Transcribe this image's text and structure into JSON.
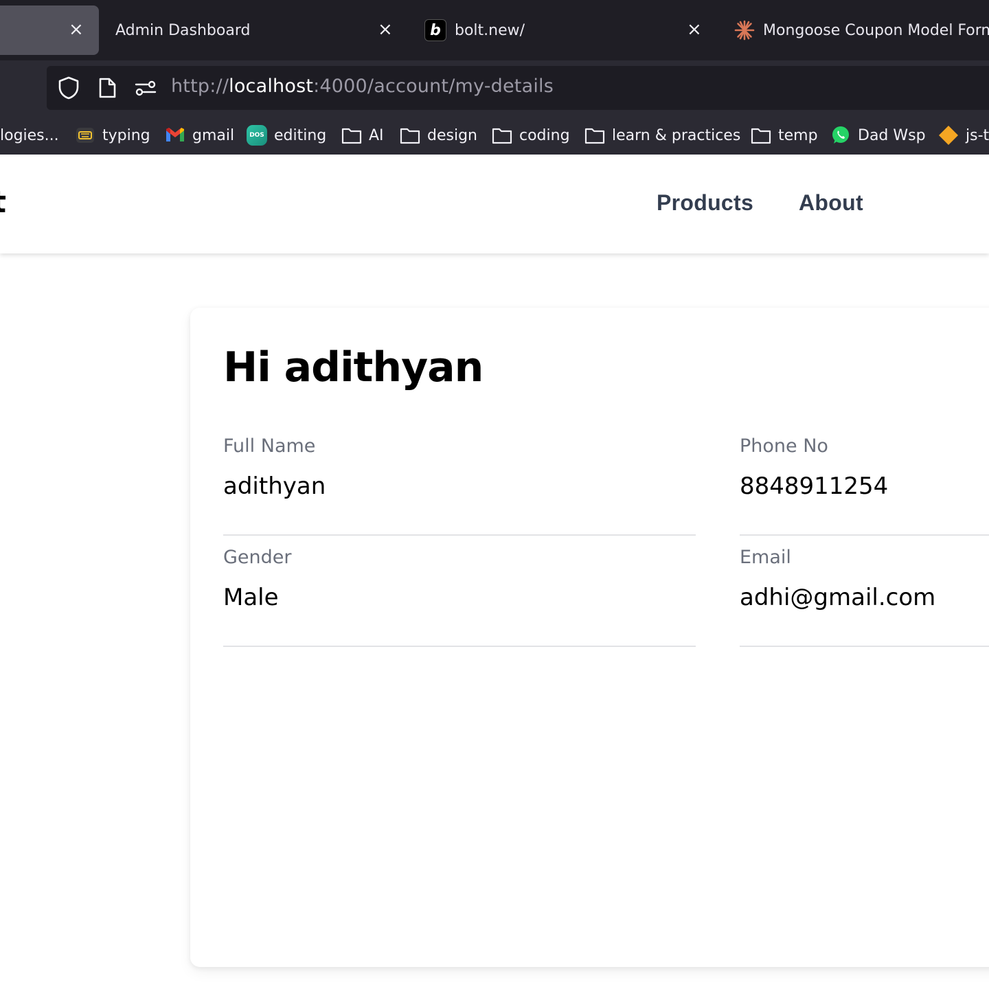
{
  "browser": {
    "tabs": [
      {
        "title": "",
        "active": true
      },
      {
        "title": "Admin Dashboard",
        "active": false
      },
      {
        "title": "bolt.new/",
        "active": false
      },
      {
        "title": "Mongoose Coupon Model Form",
        "active": false
      }
    ],
    "close_glyph": "×",
    "url": {
      "scheme": "http://",
      "host": "localhost",
      "rest": ":4000/account/my-details"
    },
    "bookmarks": [
      {
        "label": "logies...",
        "icon": "none"
      },
      {
        "label": "typing",
        "icon": "keyboard-icon"
      },
      {
        "label": "gmail",
        "icon": "gmail-icon"
      },
      {
        "label": "editing",
        "icon": "dos-icon",
        "icon_text": "DOS"
      },
      {
        "label": "AI",
        "icon": "folder-icon"
      },
      {
        "label": "design",
        "icon": "folder-icon"
      },
      {
        "label": "coding",
        "icon": "folder-icon"
      },
      {
        "label": "learn & practices",
        "icon": "folder-icon"
      },
      {
        "label": "temp",
        "icon": "folder-icon"
      },
      {
        "label": "Dad Wsp",
        "icon": "whatsapp-icon"
      },
      {
        "label": "js-t",
        "icon": "diamond-icon"
      }
    ]
  },
  "site": {
    "brand_fragment": "t",
    "nav": {
      "products": "Products",
      "about": "About"
    }
  },
  "account": {
    "greeting": "Hi adithyan",
    "fields": {
      "full_name": {
        "label": "Full Name",
        "value": "adithyan"
      },
      "phone": {
        "label": "Phone No",
        "value": "8848911254"
      },
      "gender": {
        "label": "Gender",
        "value": "Male"
      },
      "email": {
        "label": "Email",
        "value": "adhi@gmail.com"
      }
    }
  },
  "colors": {
    "tabbar_bg": "#1f1e25",
    "toolbar_bg": "#2b2a33",
    "nav_link": "#333d4f",
    "field_label": "#6a6f7b",
    "divider": "#e2e3e6"
  }
}
